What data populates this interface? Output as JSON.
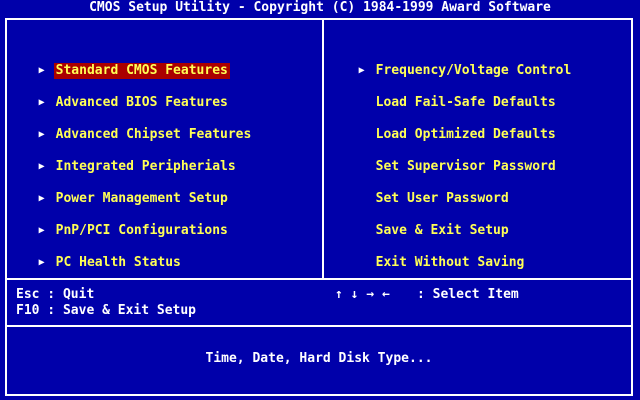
{
  "title": "CMOS Setup Utility - Copyright (C) 1984-1999 Award Software",
  "left_menu": [
    {
      "label": "Standard CMOS Features",
      "arrow": "▶",
      "selected": true
    },
    {
      "label": "Advanced BIOS Features",
      "arrow": "▶"
    },
    {
      "label": "Advanced Chipset Features",
      "arrow": "▶"
    },
    {
      "label": "Integrated Peripherials",
      "arrow": "▶"
    },
    {
      "label": "Power Management Setup",
      "arrow": "▶"
    },
    {
      "label": "PnP/PCI Configurations",
      "arrow": "▶"
    },
    {
      "label": "PC Health Status",
      "arrow": "▶"
    }
  ],
  "right_menu": [
    {
      "label": "Frequency/Voltage Control",
      "arrow": "▶"
    },
    {
      "label": "Load Fail-Safe Defaults",
      "arrow": ""
    },
    {
      "label": "Load Optimized Defaults",
      "arrow": ""
    },
    {
      "label": "Set Supervisor Password",
      "arrow": ""
    },
    {
      "label": "Set User Password",
      "arrow": ""
    },
    {
      "label": "Save & Exit Setup",
      "arrow": ""
    },
    {
      "label": "Exit Without Saving",
      "arrow": ""
    }
  ],
  "hints": {
    "esc": "Esc : Quit",
    "f10": "F10 : Save & Exit Setup",
    "arrows": "↑ ↓ → ←",
    "select": ": Select Item"
  },
  "status": "Time, Date, Hard Disk Type...",
  "colors": {
    "background": "#0000AA",
    "text": "#FFFF55",
    "highlight": "#AA0000",
    "border": "#FFFFFF"
  }
}
